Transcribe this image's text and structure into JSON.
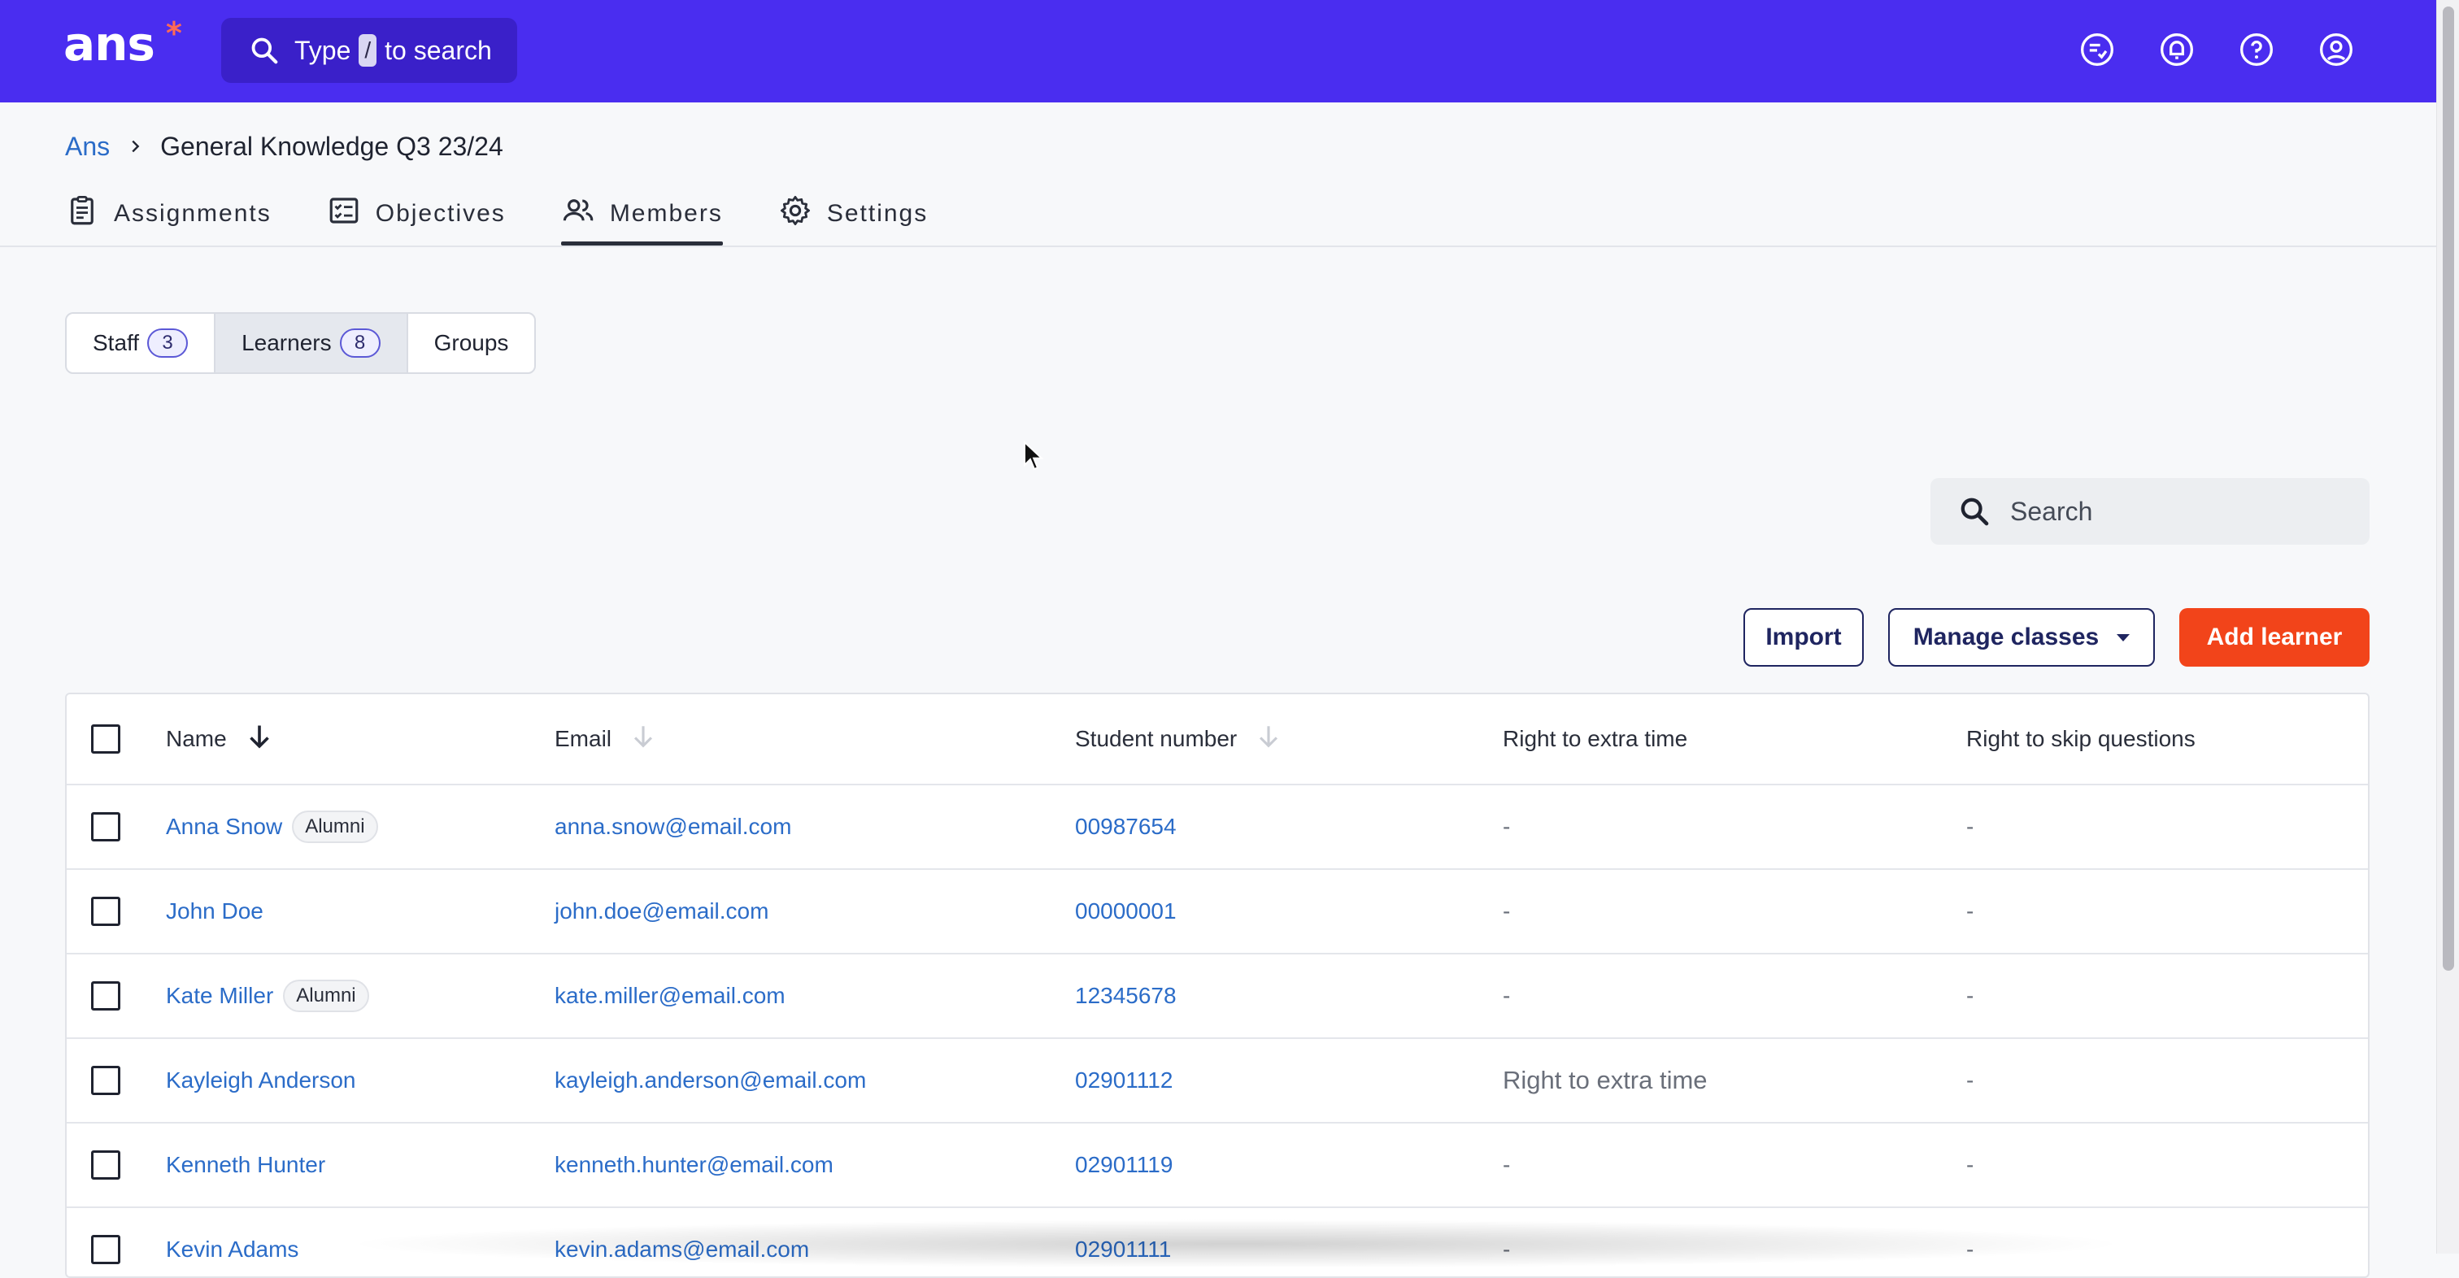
{
  "brand": {
    "logo_text": "ans",
    "logo_star": "*"
  },
  "topbar": {
    "search": {
      "prefix": "Type",
      "key": "/",
      "suffix": "to search"
    },
    "icons": [
      "checklist-icon",
      "bell-icon",
      "help-icon",
      "account-icon"
    ]
  },
  "breadcrumb": {
    "root": "Ans",
    "current": "General Knowledge Q3 23/24"
  },
  "tabs": [
    {
      "label": "Assignments",
      "icon": "clipboard-icon"
    },
    {
      "label": "Objectives",
      "icon": "checklist-box-icon"
    },
    {
      "label": "Members",
      "icon": "people-icon",
      "active": true
    },
    {
      "label": "Settings",
      "icon": "gear-icon"
    }
  ],
  "segments": {
    "staff": {
      "label": "Staff",
      "count": "3"
    },
    "learners": {
      "label": "Learners",
      "count": "8",
      "selected": true
    },
    "groups": {
      "label": "Groups"
    }
  },
  "search": {
    "placeholder": "Search"
  },
  "actions": {
    "import": "Import",
    "manage_classes": "Manage classes",
    "add_learner": "Add learner"
  },
  "colors": {
    "brand": "#4a2df0",
    "accent": "#f2441a",
    "link": "#2b6cc8"
  },
  "table": {
    "columns": {
      "name": "Name",
      "email": "Email",
      "student_number": "Student number",
      "extra_time": "Right to extra time",
      "skip_questions": "Right to skip questions"
    },
    "rows": [
      {
        "name": "Anna Snow",
        "badge": "Alumni",
        "email": "anna.snow@email.com",
        "number": "00987654",
        "extra": "-",
        "skip": "-"
      },
      {
        "name": "John Doe",
        "badge": "",
        "email": "john.doe@email.com",
        "number": "00000001",
        "extra": "-",
        "skip": "-"
      },
      {
        "name": "Kate Miller",
        "badge": "Alumni",
        "email": "kate.miller@email.com",
        "number": "12345678",
        "extra": "-",
        "skip": "-"
      },
      {
        "name": "Kayleigh Anderson",
        "badge": "",
        "email": "kayleigh.anderson@email.com",
        "number": "02901112",
        "extra": "Right to extra time",
        "skip": "-"
      },
      {
        "name": "Kenneth Hunter",
        "badge": "",
        "email": "kenneth.hunter@email.com",
        "number": "02901119",
        "extra": "-",
        "skip": "-"
      },
      {
        "name": "Kevin Adams",
        "badge": "",
        "email": "kevin.adams@email.com",
        "number": "02901111",
        "extra": "-",
        "skip": "-"
      }
    ]
  }
}
